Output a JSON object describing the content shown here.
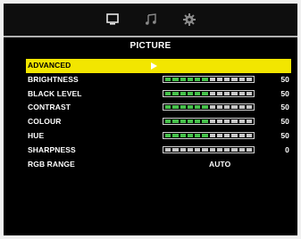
{
  "colors": {
    "background": "#000000",
    "highlight": "#f2e600",
    "bar_fill": "#46c14b",
    "bar_empty": "#c8c8c8"
  },
  "tabs": [
    {
      "icon": "monitor-icon",
      "active": true
    },
    {
      "icon": "music-note-icon",
      "active": false
    },
    {
      "icon": "gear-icon",
      "active": false
    }
  ],
  "page_title": "PICTURE",
  "menu": {
    "advanced": {
      "label": "ADVANCED"
    },
    "brightness": {
      "label": "BRIGHTNESS",
      "value": "50",
      "level": 0.5
    },
    "black_level": {
      "label": "BLACK LEVEL",
      "value": "50",
      "level": 0.5
    },
    "contrast": {
      "label": "CONTRAST",
      "value": "50",
      "level": 0.5
    },
    "colour": {
      "label": "COLOUR",
      "value": "50",
      "level": 0.5
    },
    "hue": {
      "label": "HUE",
      "value": "50",
      "level": 0.5
    },
    "sharpness": {
      "label": "SHARPNESS",
      "value": "0",
      "level": 0
    },
    "rgb_range": {
      "label": "RGB RANGE",
      "value": "AUTO"
    }
  }
}
